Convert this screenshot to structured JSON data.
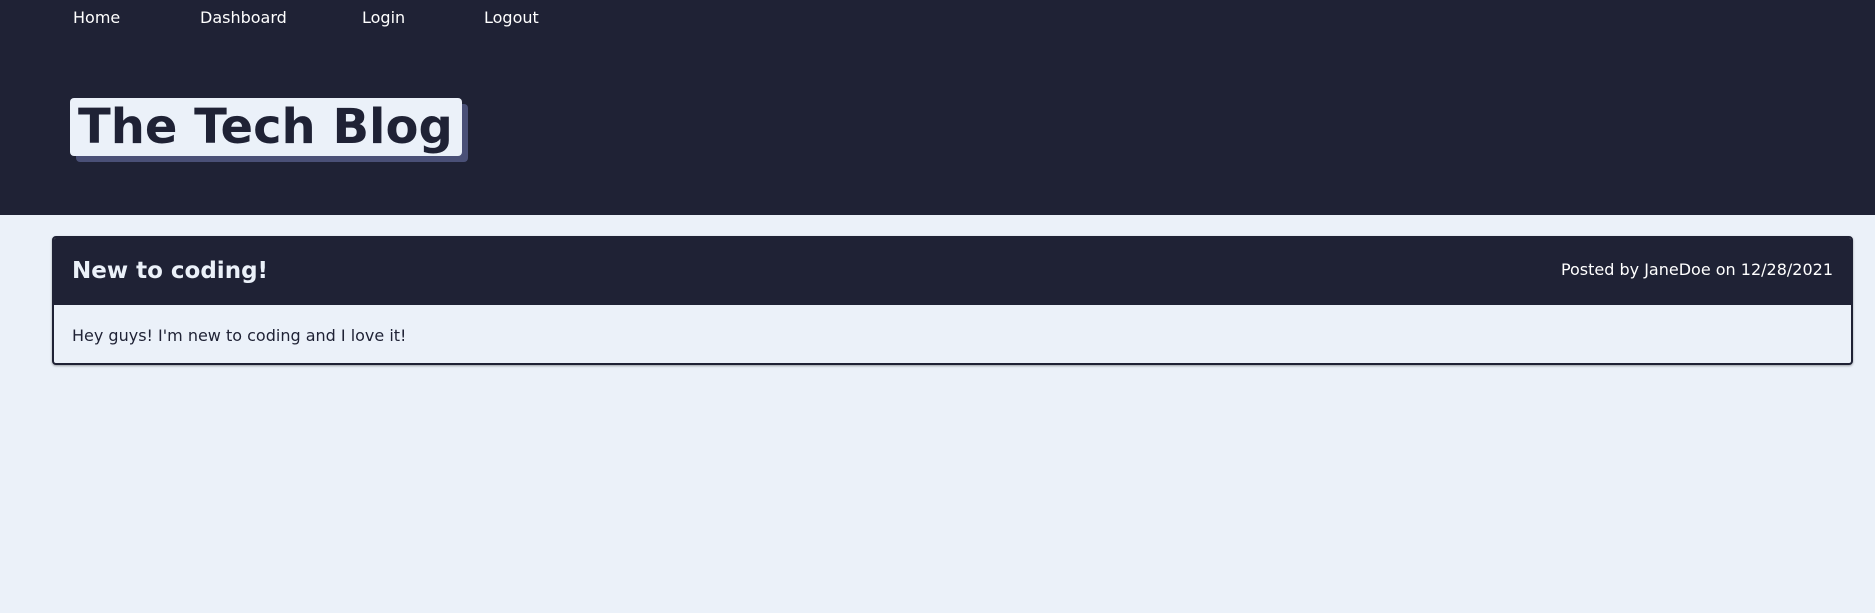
{
  "nav": {
    "home_label": "Home",
    "dashboard_label": "Dashboard",
    "login_label": "Login",
    "logout_label": "Logout"
  },
  "header": {
    "title": "The Tech Blog"
  },
  "posts": [
    {
      "title": "New to coding!",
      "meta": "Posted by JaneDoe on 12/28/2021",
      "body": "Hey guys! I'm new to coding and I love it!"
    }
  ],
  "colors": {
    "header_bg": "#1f2235",
    "page_bg": "#ebf1f9",
    "brand_shadow": "#4a5077",
    "text_light": "#ffffff",
    "text_dark": "#1f2235"
  }
}
